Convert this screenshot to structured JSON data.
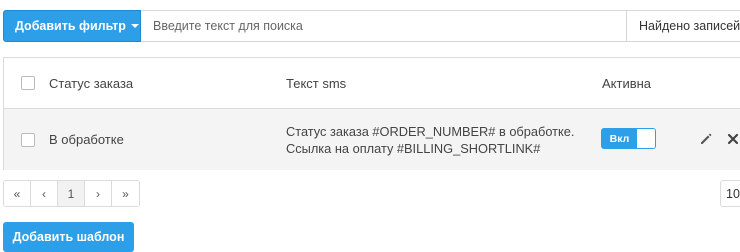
{
  "toolbar": {
    "filter_button": "Добавить фильтр",
    "search_placeholder": "Введите текст для поиска",
    "found_label": "Найдено записей"
  },
  "table": {
    "headers": {
      "status": "Статус заказа",
      "sms_text": "Текст sms",
      "active": "Активна"
    },
    "rows": [
      {
        "status": "В обработке",
        "sms_line1": "Статус заказа #ORDER_NUMBER# в обработке.",
        "sms_line2": "Ссылка на оплату #BILLING_SHORTLINK#",
        "toggle_label": "Вкл"
      }
    ]
  },
  "pagination": {
    "first": "«",
    "prev": "‹",
    "current": "1",
    "next": "›",
    "last": "»",
    "per_page": "10"
  },
  "footer": {
    "add_template_button": "Добавить шаблон"
  },
  "colors": {
    "primary": "#2d9ee8",
    "row_background": "#f4f4f4",
    "border": "#d9dcdf"
  },
  "icons": {
    "edit": "pencil-icon",
    "delete": "close-icon"
  }
}
